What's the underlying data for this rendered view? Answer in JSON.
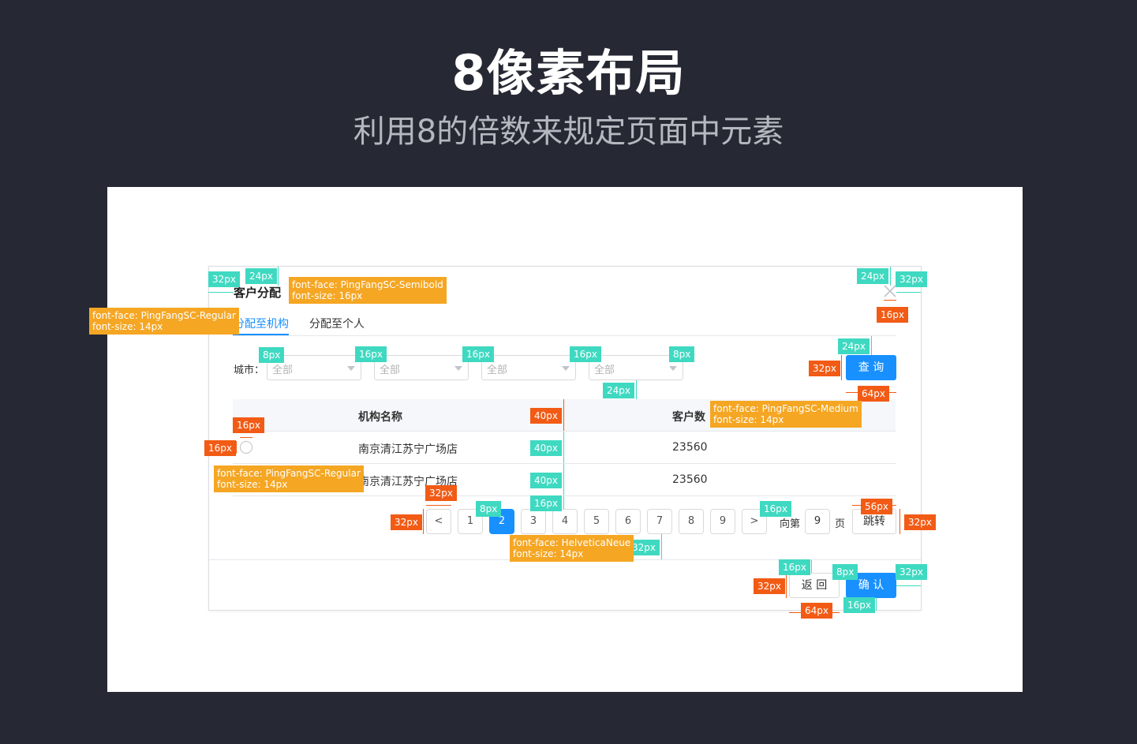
{
  "header": {
    "title": "8像素布局",
    "subtitle": "利用8的倍数来规定页面中元素"
  },
  "dialog": {
    "title": "客户分配",
    "tabs": [
      {
        "label": "分配至机构",
        "active": true
      },
      {
        "label": "分配至个人",
        "active": false
      }
    ],
    "filter": {
      "label": "城市：",
      "selects": [
        "全部",
        "全部",
        "全部",
        "全部"
      ],
      "query_button": "查 询"
    },
    "table": {
      "headers": [
        "机构名称",
        "客户数"
      ],
      "rows": [
        {
          "name": "南京清江苏宁广场店",
          "count": "23560"
        },
        {
          "name": "南京清江苏宁广场店",
          "count": "23560"
        }
      ]
    },
    "pagination": {
      "prev": "<",
      "pages": [
        "1",
        "2",
        "3",
        "4",
        "5",
        "6",
        "7",
        "8",
        "9"
      ],
      "current_page": "2",
      "next": ">",
      "goto_prefix": "向第",
      "goto_value": "9",
      "goto_suffix": "页",
      "jump_button": "跳转"
    },
    "footer": {
      "back_button": "返 回",
      "confirm_button": "确 认"
    }
  },
  "annotations": {
    "spacing": [
      "32px",
      "24px",
      "24px",
      "32px",
      "16px",
      "8px",
      "16px",
      "16px",
      "16px",
      "8px",
      "24px",
      "32px",
      "24px",
      "64px",
      "40px",
      "16px",
      "16px",
      "40px",
      "40px",
      "32px",
      "8px",
      "32px",
      "16px",
      "16px",
      "56px",
      "32px",
      "32px",
      "16px",
      "8px",
      "32px",
      "32px",
      "64px",
      "16px"
    ],
    "fonts": {
      "title_font": "font-face: PingFangSC-Semibold",
      "title_size": "font-size: 16px",
      "tab_font": "font-face: PingFangSC-Regular",
      "tab_size": "font-size: 14px",
      "header_font": "font-face: PingFangSC-Medium",
      "header_size": "font-size: 14px",
      "cell_font": "font-face: PingFangSC-Regular",
      "cell_size": "font-size: 14px",
      "page_font": "font-face: HelveticaNeue",
      "page_size": "font-size: 14px"
    }
  },
  "colors": {
    "background": "#262833",
    "primary": "#1890ff",
    "annotation_teal": "#3fd9c1",
    "annotation_red": "#f25b15",
    "annotation_orange": "#f5a623"
  }
}
